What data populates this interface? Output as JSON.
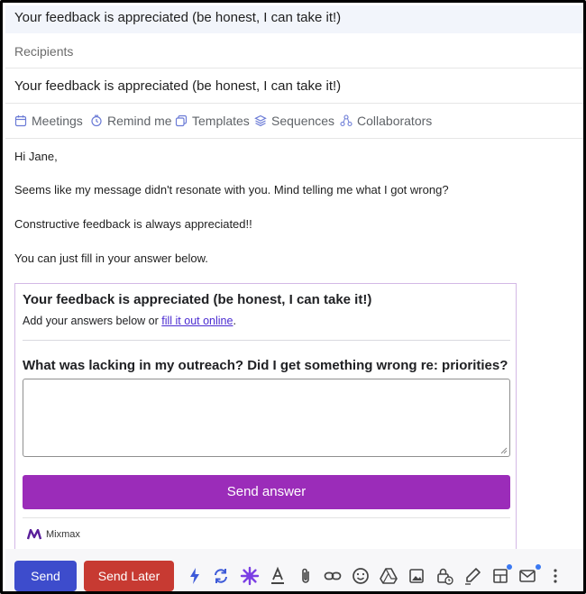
{
  "window": {
    "title": "Your feedback is appreciated (be honest, I can take it!)"
  },
  "compose": {
    "recipients_placeholder": "Recipients",
    "subject": "Your feedback is appreciated (be honest, I can take it!)"
  },
  "mixmax_bar": {
    "items": [
      {
        "label": "Meetings",
        "icon": "calendar-icon"
      },
      {
        "label": "Remind me",
        "icon": "clock-icon"
      },
      {
        "label": "Templates",
        "icon": "templates-icon"
      },
      {
        "label": "Sequences",
        "icon": "layers-icon"
      },
      {
        "label": "Collaborators",
        "icon": "people-icon"
      }
    ]
  },
  "message": {
    "greeting": "Hi Jane,",
    "line1": "Seems like my message didn't resonate with you. Mind telling me what I got wrong?",
    "line2": "Constructive feedback is always appreciated!!",
    "line3": "You can just fill in your answer below."
  },
  "survey": {
    "title": "Your feedback is appreciated (be honest, I can take it!)",
    "subtitle_prefix": "Add your answers below or ",
    "subtitle_link": "fill it out online",
    "subtitle_suffix": ".",
    "question": "What was lacking in my outreach? Did I get something wrong re: priorities?",
    "answer_value": "",
    "submit_label": "Send answer",
    "brand": "Mixmax",
    "accent_color": "#9b2cb9"
  },
  "toolbar": {
    "send_label": "Send",
    "send_later_label": "Send Later",
    "send_color": "#3d4ccc",
    "send_later_color": "#c73a32",
    "icons": [
      "lightning-icon",
      "sync-icon",
      "mixmax-spark-icon",
      "text-format-icon",
      "attachment-icon",
      "link-icon",
      "emoji-icon",
      "drive-icon",
      "photo-icon",
      "confidential-lock-icon",
      "signature-pen-icon",
      "layout-icon",
      "mail-icon",
      "more-options-icon"
    ]
  }
}
